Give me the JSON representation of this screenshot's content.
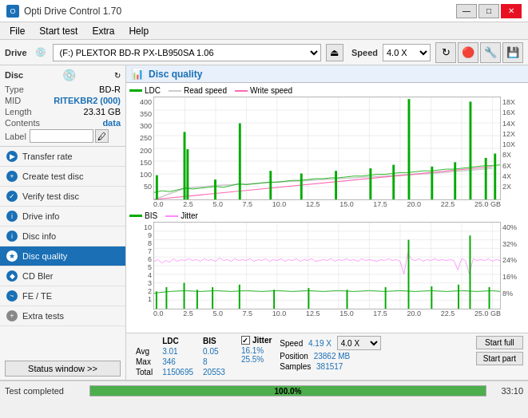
{
  "titleBar": {
    "title": "Opti Drive Control 1.70",
    "minBtn": "—",
    "maxBtn": "□",
    "closeBtn": "✕"
  },
  "menuBar": {
    "items": [
      "File",
      "Start test",
      "Extra",
      "Help"
    ]
  },
  "driveBar": {
    "label": "Drive",
    "driveValue": "(F:)  PLEXTOR BD-R  PX-LB950SA 1.06",
    "speedLabel": "Speed",
    "speedValue": "4.0 X"
  },
  "disc": {
    "sectionTitle": "Disc",
    "typeLabel": "Type",
    "typeValue": "BD-R",
    "midLabel": "MID",
    "midValue": "RITEKBR2 (000)",
    "lengthLabel": "Length",
    "lengthValue": "23.31 GB",
    "contentsLabel": "Contents",
    "contentsValue": "data",
    "labelLabel": "Label"
  },
  "navItems": [
    {
      "id": "transfer-rate",
      "label": "Transfer rate",
      "active": false
    },
    {
      "id": "create-test-disc",
      "label": "Create test disc",
      "active": false
    },
    {
      "id": "verify-test-disc",
      "label": "Verify test disc",
      "active": false
    },
    {
      "id": "drive-info",
      "label": "Drive info",
      "active": false
    },
    {
      "id": "disc-info",
      "label": "Disc info",
      "active": false
    },
    {
      "id": "disc-quality",
      "label": "Disc quality",
      "active": true
    },
    {
      "id": "cd-bler",
      "label": "CD Bler",
      "active": false
    },
    {
      "id": "fe-te",
      "label": "FE / TE",
      "active": false
    },
    {
      "id": "extra-tests",
      "label": "Extra tests",
      "active": false
    }
  ],
  "statusBtn": "Status window >>",
  "chartTitle": "Disc quality",
  "legend1": {
    "ldc": "LDC",
    "read": "Read speed",
    "write": "Write speed"
  },
  "legend2": {
    "bis": "BIS",
    "jitter": "Jitter"
  },
  "chart1": {
    "yMax": 400,
    "yLabels": [
      "400",
      "350",
      "300",
      "250",
      "200",
      "150",
      "100",
      "50"
    ],
    "yLabelsRight": [
      "18X",
      "16X",
      "14X",
      "12X",
      "10X",
      "8X",
      "6X",
      "4X",
      "2X"
    ],
    "xLabels": [
      "0.0",
      "2.5",
      "5.0",
      "7.5",
      "10.0",
      "12.5",
      "15.0",
      "17.5",
      "20.0",
      "22.5",
      "25.0 GB"
    ]
  },
  "chart2": {
    "yMax": 10,
    "yLabels": [
      "10",
      "9",
      "8",
      "7",
      "6",
      "5",
      "4",
      "3",
      "2",
      "1"
    ],
    "yLabelsRight": [
      "40%",
      "32%",
      "24%",
      "16%",
      "8%"
    ],
    "xLabels": [
      "0.0",
      "2.5",
      "5.0",
      "7.5",
      "10.0",
      "12.5",
      "15.0",
      "17.5",
      "20.0",
      "22.5",
      "25.0 GB"
    ]
  },
  "stats": {
    "ldcLabel": "LDC",
    "bisLabel": "BIS",
    "jitterLabel": "Jitter",
    "avgLabel": "Avg",
    "maxLabel": "Max",
    "totalLabel": "Total",
    "ldcAvg": "3.01",
    "ldcMax": "346",
    "ldcTotal": "1150695",
    "bisAvg": "0.05",
    "bisMax": "8",
    "bisTotal": "20553",
    "jitterAvg": "16.1%",
    "jitterMax": "25.5%",
    "speedLabel": "Speed",
    "speedVal": "4.19 X",
    "speedDropVal": "4.0 X",
    "positionLabel": "Position",
    "positionVal": "23862 MB",
    "samplesLabel": "Samples",
    "samplesVal": "381517",
    "startFullBtn": "Start full",
    "startPartBtn": "Start part"
  },
  "bottomBar": {
    "statusText": "Test completed",
    "progressPct": "100.0%",
    "timeText": "33:10"
  }
}
